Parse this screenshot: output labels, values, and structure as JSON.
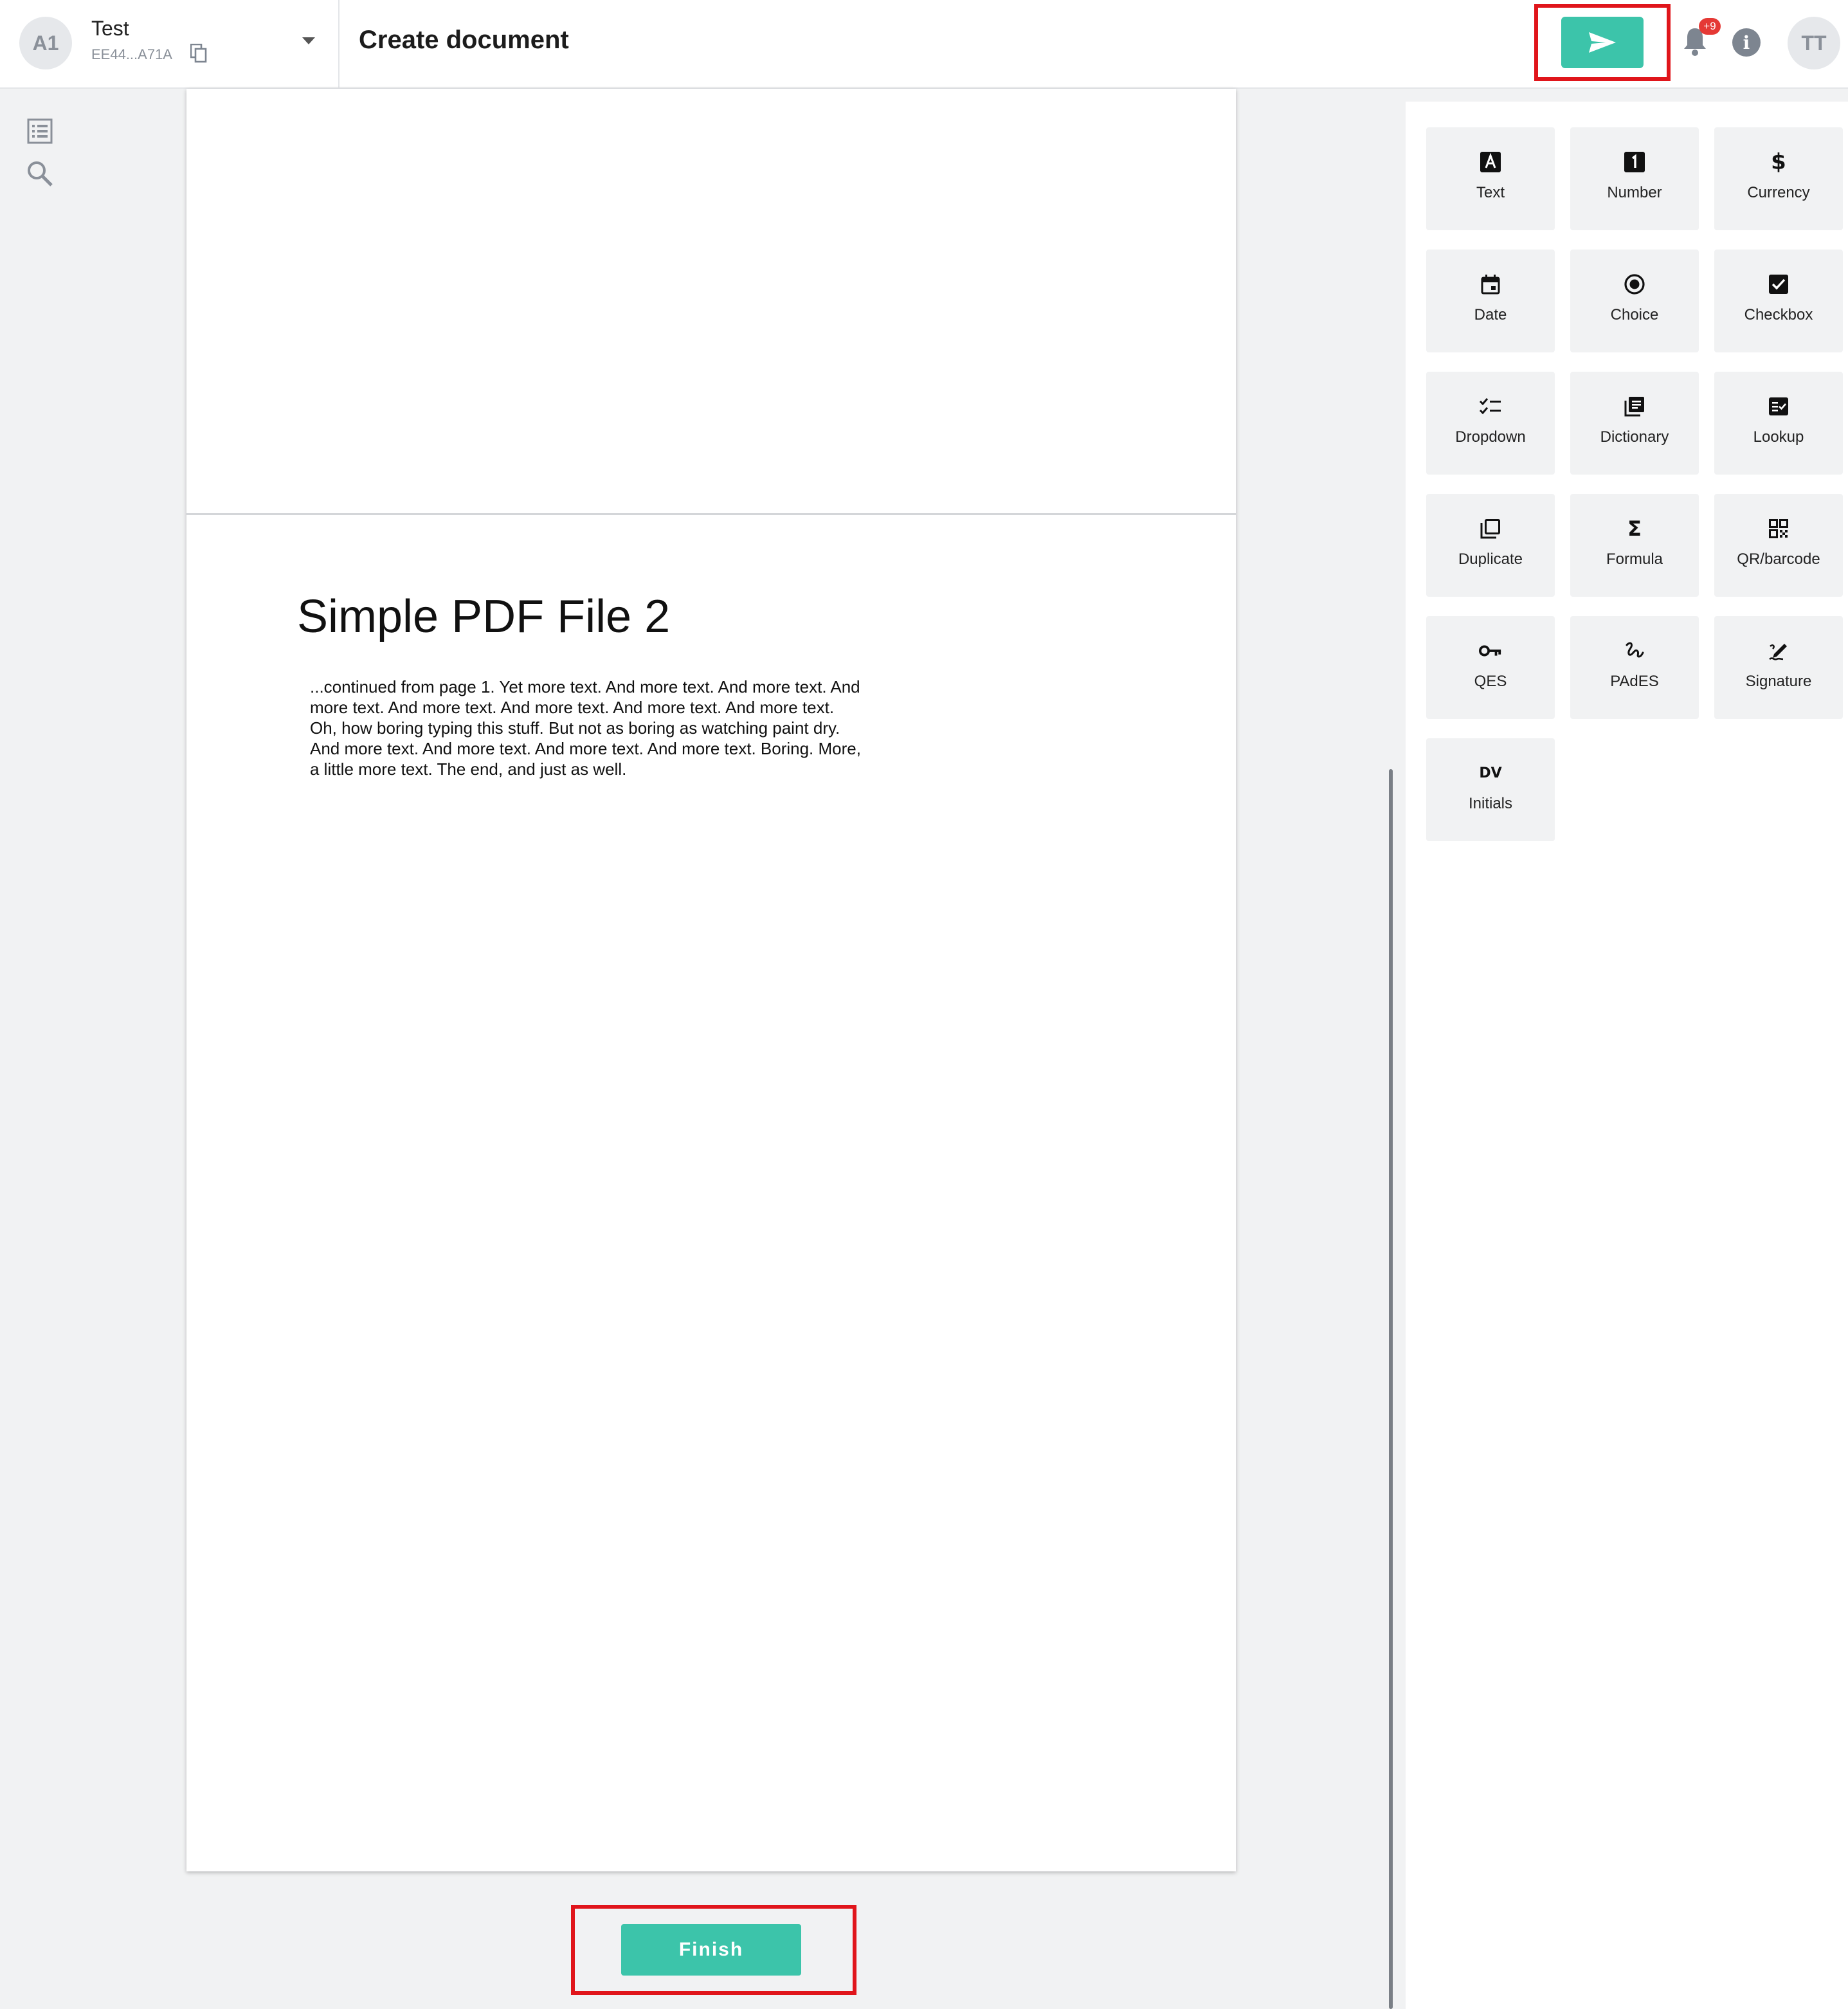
{
  "account": {
    "initials": "A1",
    "name": "Test",
    "id": "EE44...A71A"
  },
  "header": {
    "title": "Create document",
    "notification_badge": "+9",
    "user_initials": "TT"
  },
  "document": {
    "title": "Simple PDF File 2",
    "paragraph": "...continued from page 1. Yet more text. And more text. And more text. And more text. And more text. And more text. And more text. And more text. Oh, how boring typing this stuff. But not as boring as watching paint dry. And more text. And more text. And more text. And more text. Boring.  More, a little more text. The end, and just as well."
  },
  "finish_label": "Finish",
  "fields": [
    {
      "label": "Text",
      "icon": "text-icon"
    },
    {
      "label": "Number",
      "icon": "number-icon"
    },
    {
      "label": "Currency",
      "icon": "currency-icon"
    },
    {
      "label": "Date",
      "icon": "calendar-icon"
    },
    {
      "label": "Choice",
      "icon": "radio-icon"
    },
    {
      "label": "Checkbox",
      "icon": "checkbox-icon"
    },
    {
      "label": "Dropdown",
      "icon": "checklist-icon"
    },
    {
      "label": "Dictionary",
      "icon": "library-icon"
    },
    {
      "label": "Lookup",
      "icon": "lookup-icon"
    },
    {
      "label": "Duplicate",
      "icon": "duplicate-icon"
    },
    {
      "label": "Formula",
      "icon": "sigma-icon"
    },
    {
      "label": "QR/barcode",
      "icon": "qr-icon"
    },
    {
      "label": "QES",
      "icon": "key-icon"
    },
    {
      "label": "PAdES",
      "icon": "signature-scribble-icon"
    },
    {
      "label": "Signature",
      "icon": "pen-signature-icon"
    },
    {
      "label": "Initials",
      "icon": "initials-icon",
      "glyph": "DV"
    }
  ],
  "colors": {
    "accent": "#3cc4aa",
    "highlight": "#e0151b",
    "badge": "#e53935"
  }
}
